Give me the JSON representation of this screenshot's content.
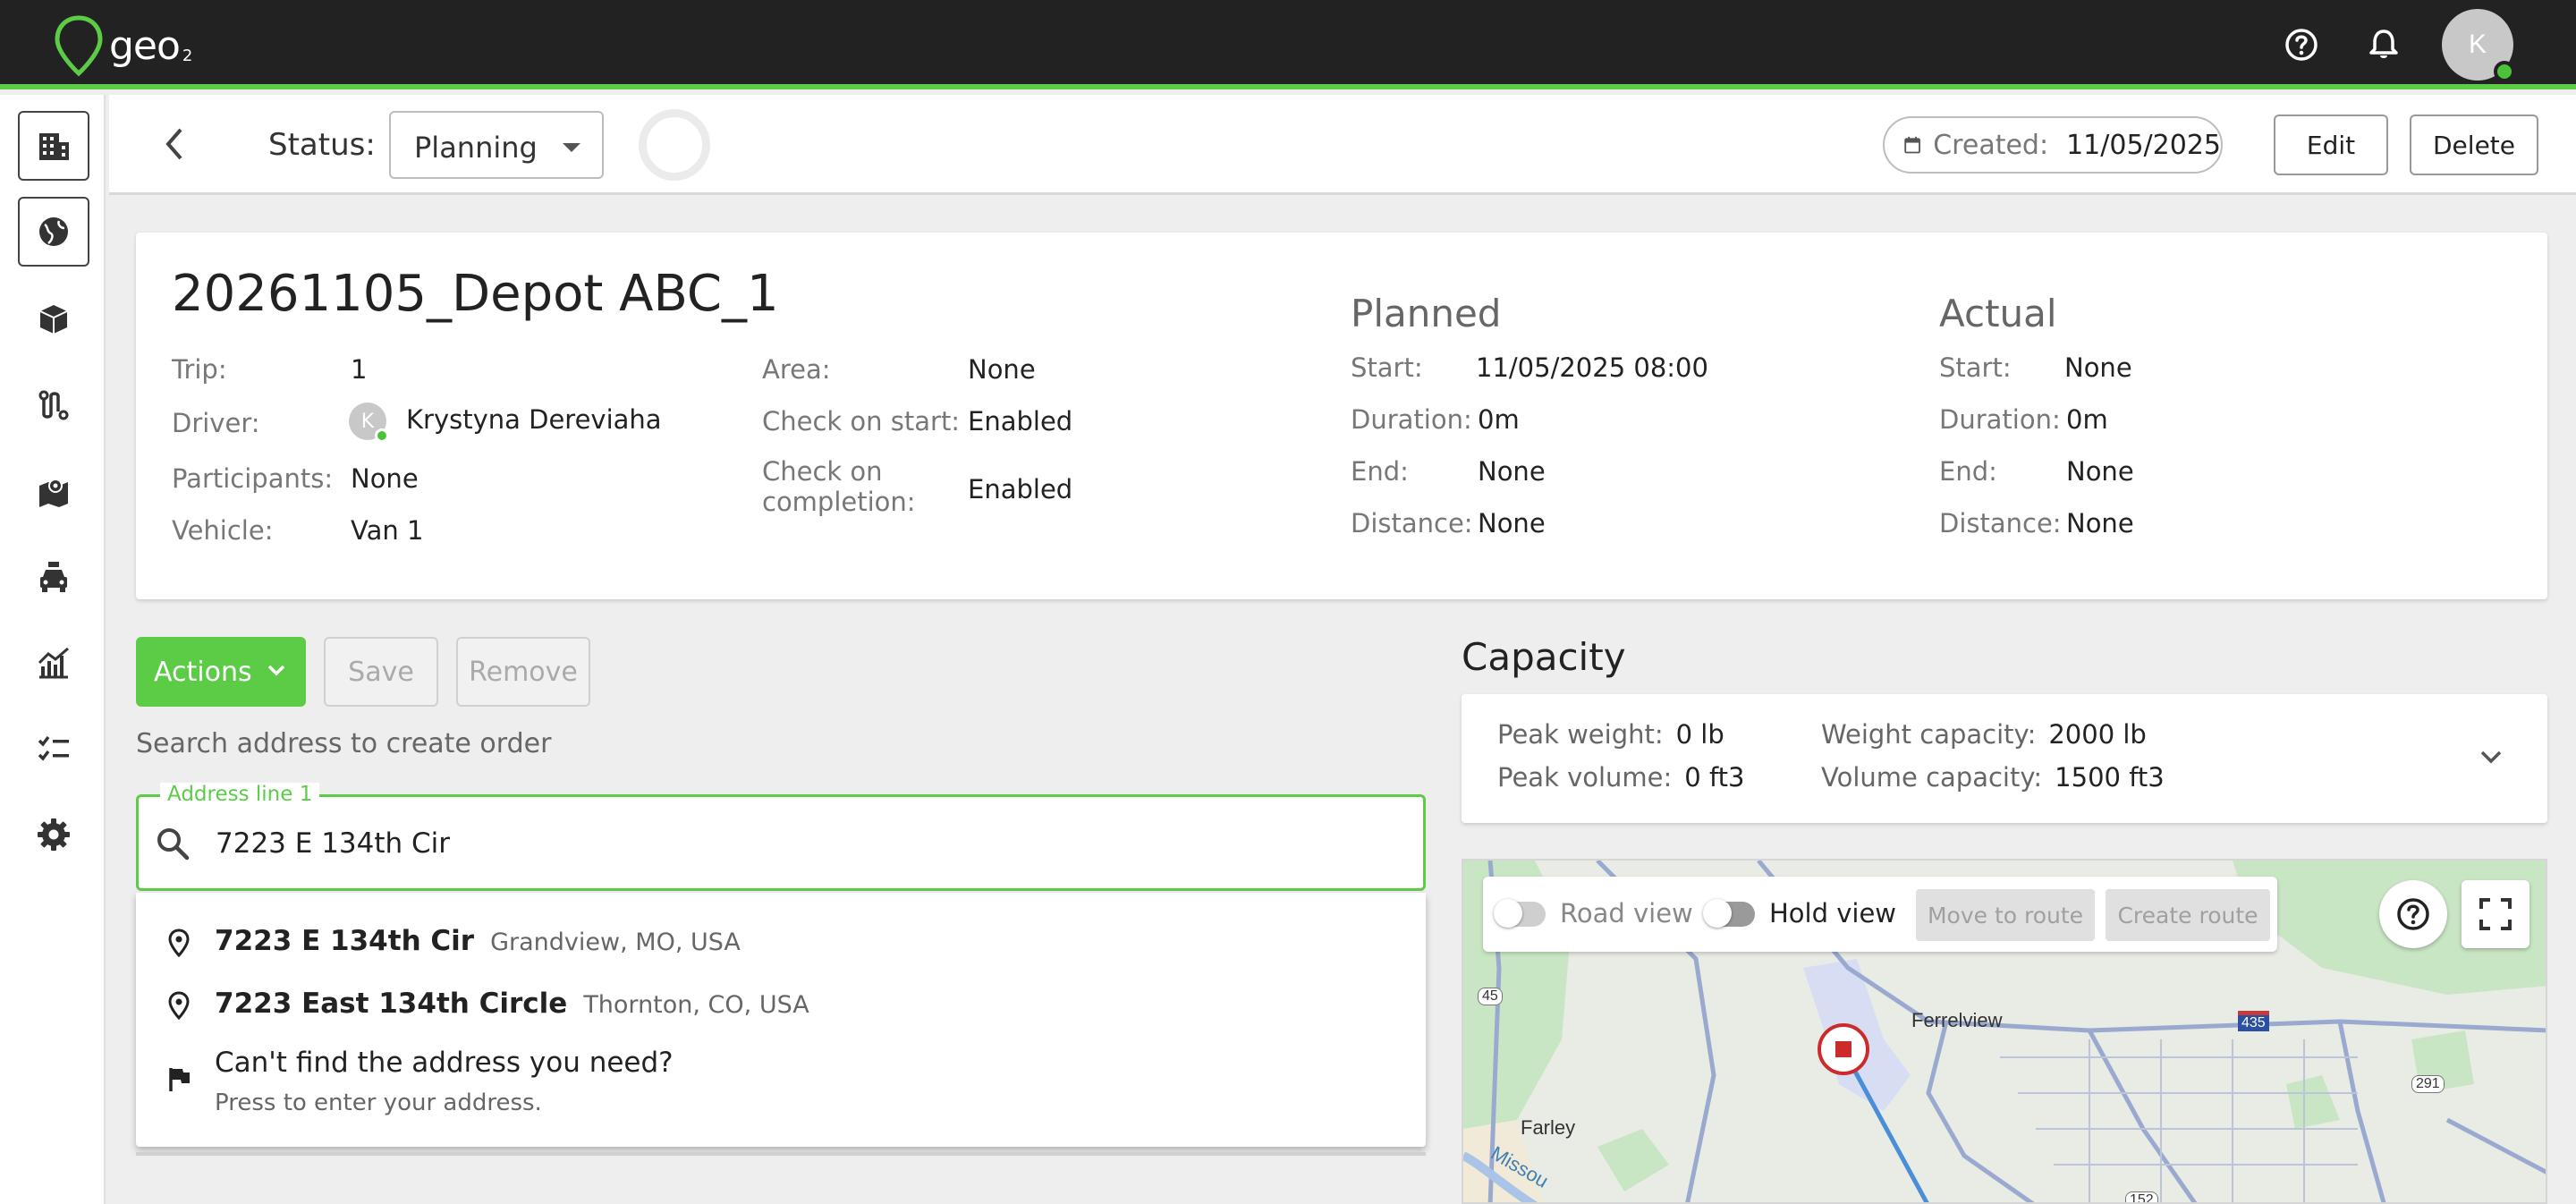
{
  "app": {
    "logo_text": "geo",
    "logo_sub": "2",
    "user_initial": "K"
  },
  "header": {
    "status_label": "Status:",
    "status_value": "Planning",
    "created_label": "Created:",
    "created_value": "11/05/2025",
    "edit_label": "Edit",
    "delete_label": "Delete"
  },
  "trip": {
    "title": "20261105_Depot ABC_1",
    "fields": {
      "trip_label": "Trip:",
      "trip_value": "1",
      "driver_label": "Driver:",
      "driver_initial": "K",
      "driver_value": "Krystyna Dereviaha",
      "participants_label": "Participants:",
      "participants_value": "None",
      "vehicle_label": "Vehicle:",
      "vehicle_value": "Van 1",
      "area_label": "Area:",
      "area_value": "None",
      "check_start_label": "Check on start:",
      "check_start_value": "Enabled",
      "check_completion_label_1": "Check on",
      "check_completion_label_2": "completion:",
      "check_completion_value": "Enabled"
    },
    "planned": {
      "heading": "Planned",
      "start_label": "Start:",
      "start_value": "11/05/2025 08:00",
      "duration_label": "Duration:",
      "duration_value": "0m",
      "end_label": "End:",
      "end_value": "None",
      "distance_label": "Distance:",
      "distance_value": "None"
    },
    "actual": {
      "heading": "Actual",
      "start_label": "Start:",
      "start_value": "None",
      "duration_label": "Duration:",
      "duration_value": "0m",
      "end_label": "End:",
      "end_value": "None",
      "distance_label": "Distance:",
      "distance_value": "None"
    }
  },
  "toolbar": {
    "actions_label": "Actions",
    "save_label": "Save",
    "remove_label": "Remove"
  },
  "search": {
    "hint": "Search address to create order",
    "legend": "Address line 1",
    "value": "7223 E 134th Cir",
    "suggestions": [
      {
        "main": "7223 E 134th Cir",
        "sub": "Grandview, MO, USA"
      },
      {
        "main": "7223 East 134th Circle",
        "sub": "Thornton, CO, USA"
      }
    ],
    "manual_title": "Can't find the address you need?",
    "manual_sub": "Press to enter your address."
  },
  "capacity": {
    "title": "Capacity",
    "peak_weight_label": "Peak weight:",
    "peak_weight_value": "0 lb",
    "peak_volume_label": "Peak volume:",
    "peak_volume_value": "0 ft3",
    "weight_capacity_label": "Weight capacity:",
    "weight_capacity_value": "2000 lb",
    "volume_capacity_label": "Volume capacity:",
    "volume_capacity_value": "1500 ft3"
  },
  "map": {
    "road_view_label": "Road view",
    "hold_view_label": "Hold view",
    "move_to_route_label": "Move to route",
    "create_route_label": "Create route",
    "labels": {
      "ferrelview": "Ferrelview",
      "farley": "Farley",
      "missouri": "Missou",
      "r45": "45",
      "r435": "435",
      "r291": "291",
      "r152": "152"
    }
  }
}
